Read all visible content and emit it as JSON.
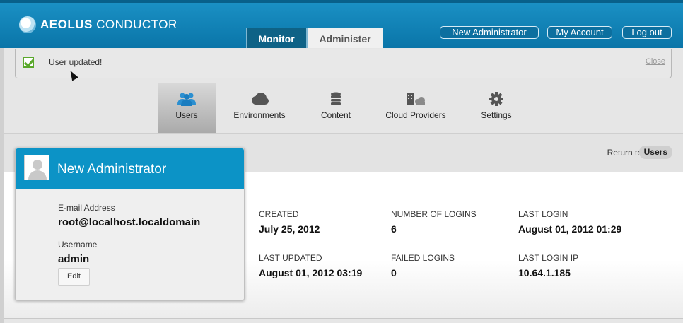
{
  "header": {
    "logo_bold": "AEOLUS",
    "logo_rest": " CONDUCTOR",
    "tabs": [
      "Monitor",
      "Administer"
    ],
    "buttons": {
      "new_admin": "New Administrator",
      "my_account": "My Account",
      "logout": "Log out"
    }
  },
  "flash": {
    "message": "User updated!",
    "close": "Close"
  },
  "nav": {
    "items": [
      {
        "label": "Users",
        "icon": "users-icon"
      },
      {
        "label": "Environments",
        "icon": "cloud-icon"
      },
      {
        "label": "Content",
        "icon": "database-icon"
      },
      {
        "label": "Cloud Providers",
        "icon": "building-cloud-icon"
      },
      {
        "label": "Settings",
        "icon": "gear-icon"
      }
    ]
  },
  "return": {
    "label": "Return to",
    "target": "Users"
  },
  "card": {
    "title": "New Administrator",
    "email_label": "E-mail Address",
    "email": "root@localhost.localdomain",
    "username_label": "Username",
    "username": "admin",
    "edit": "Edit"
  },
  "stats": {
    "created_label": "CREATED",
    "created": "July 25, 2012",
    "logins_label": "NUMBER OF LOGINS",
    "logins": "6",
    "last_login_label": "LAST LOGIN",
    "last_login": "August 01, 2012 01:29",
    "updated_label": "LAST UPDATED",
    "updated": "August 01, 2012 03:19",
    "failed_label": "FAILED LOGINS",
    "failed": "0",
    "ip_label": "LAST LOGIN IP",
    "ip": "10.64.1.185"
  },
  "colors": {
    "header": "#0a75a8",
    "card_header": "#0c93c6",
    "success": "#5aa82c"
  }
}
